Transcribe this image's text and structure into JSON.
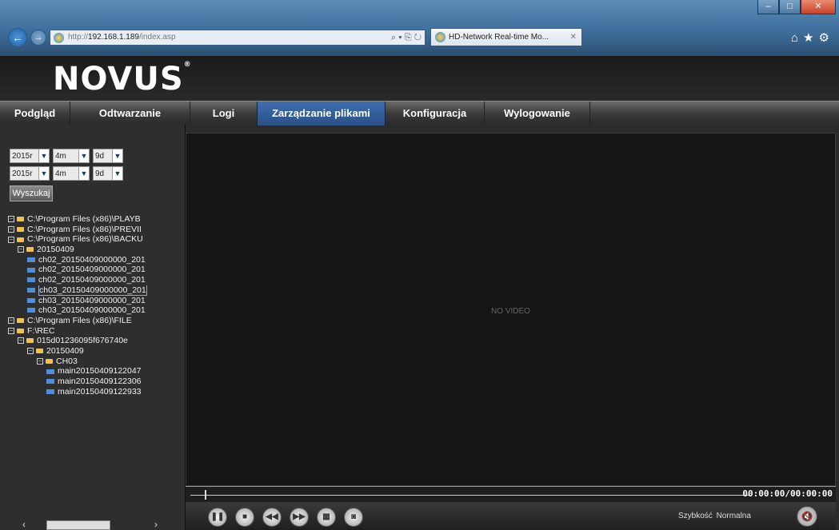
{
  "browser": {
    "address_prefix": "http://",
    "address_host": "192.168.1.189",
    "address_path": "/index.asp",
    "tab_title": "HD-Network Real-time Mo...",
    "tab_close": "✕",
    "addr_tools": "⌕ ▾ ⎘ ↻",
    "right_icons": "⌂★⚙",
    "win_min": "–",
    "win_max": "□",
    "win_close": "✕"
  },
  "app": {
    "logo": "NOVUS",
    "logo_mark": "®"
  },
  "menu": [
    {
      "label": "Podgląd",
      "active": false
    },
    {
      "label": "Odtwarzanie",
      "active": false
    },
    {
      "label": "Logi",
      "active": false
    },
    {
      "label": "Zarządzanie plikami",
      "active": true
    },
    {
      "label": "Konfiguracja",
      "active": false
    },
    {
      "label": "Wylogowanie",
      "active": false
    }
  ],
  "search": {
    "from": {
      "year": "2015r",
      "month": "4m",
      "day": "9d"
    },
    "to": {
      "year": "2015r",
      "month": "4m",
      "day": "9d"
    },
    "button": "Wyszukaj"
  },
  "tree": [
    {
      "depth": 0,
      "type": "folder",
      "toggle": "−",
      "label": "C:\\Program Files (x86)\\PLAYB"
    },
    {
      "depth": 0,
      "type": "folder",
      "toggle": "−",
      "label": "C:\\Program Files (x86)\\PREVII"
    },
    {
      "depth": 0,
      "type": "folder",
      "toggle": "−",
      "label": "C:\\Program Files (x86)\\BACKU"
    },
    {
      "depth": 1,
      "type": "folder",
      "toggle": "−",
      "label": "20150409"
    },
    {
      "depth": 2,
      "type": "file",
      "label": "ch02_20150409000000_201"
    },
    {
      "depth": 2,
      "type": "file",
      "label": "ch02_20150409000000_201"
    },
    {
      "depth": 2,
      "type": "file",
      "label": "ch02_20150409000000_201"
    },
    {
      "depth": 2,
      "type": "file",
      "label": "ch03_20150409000000_201",
      "selected": true
    },
    {
      "depth": 2,
      "type": "file",
      "label": "ch03_20150409000000_201"
    },
    {
      "depth": 2,
      "type": "file",
      "label": "ch03_20150409000000_201"
    },
    {
      "depth": 0,
      "type": "folder",
      "toggle": "−",
      "label": "C:\\Program Files (x86)\\FILE"
    },
    {
      "depth": 0,
      "type": "folder",
      "toggle": "−",
      "label": "F:\\REC"
    },
    {
      "depth": 1,
      "type": "folder",
      "toggle": "−",
      "label": "015d01236095f676740e"
    },
    {
      "depth": 2,
      "type": "folder",
      "toggle": "−",
      "label": "20150409"
    },
    {
      "depth": 3,
      "type": "folder",
      "toggle": "−",
      "label": "CH03"
    },
    {
      "depth": 4,
      "type": "file",
      "label": "main20150409122047"
    },
    {
      "depth": 4,
      "type": "file",
      "label": "main20150409122306"
    },
    {
      "depth": 4,
      "type": "file",
      "label": "main20150409122933"
    }
  ],
  "video": {
    "placeholder": "NO VIDEO",
    "time": "00:00:00/00:00:00",
    "progress": 0
  },
  "controls": {
    "pause_glyph": "❚❚",
    "stop_glyph": "■",
    "rewind_glyph": "◀◀",
    "forward_glyph": "▶▶",
    "clip_glyph": "▦",
    "snapshot_glyph": "◙",
    "mute_glyph": "🔇",
    "speed_label": "Szybkość",
    "speed_value": "Normalna"
  },
  "scroll": {
    "left": "‹",
    "right": "›"
  }
}
